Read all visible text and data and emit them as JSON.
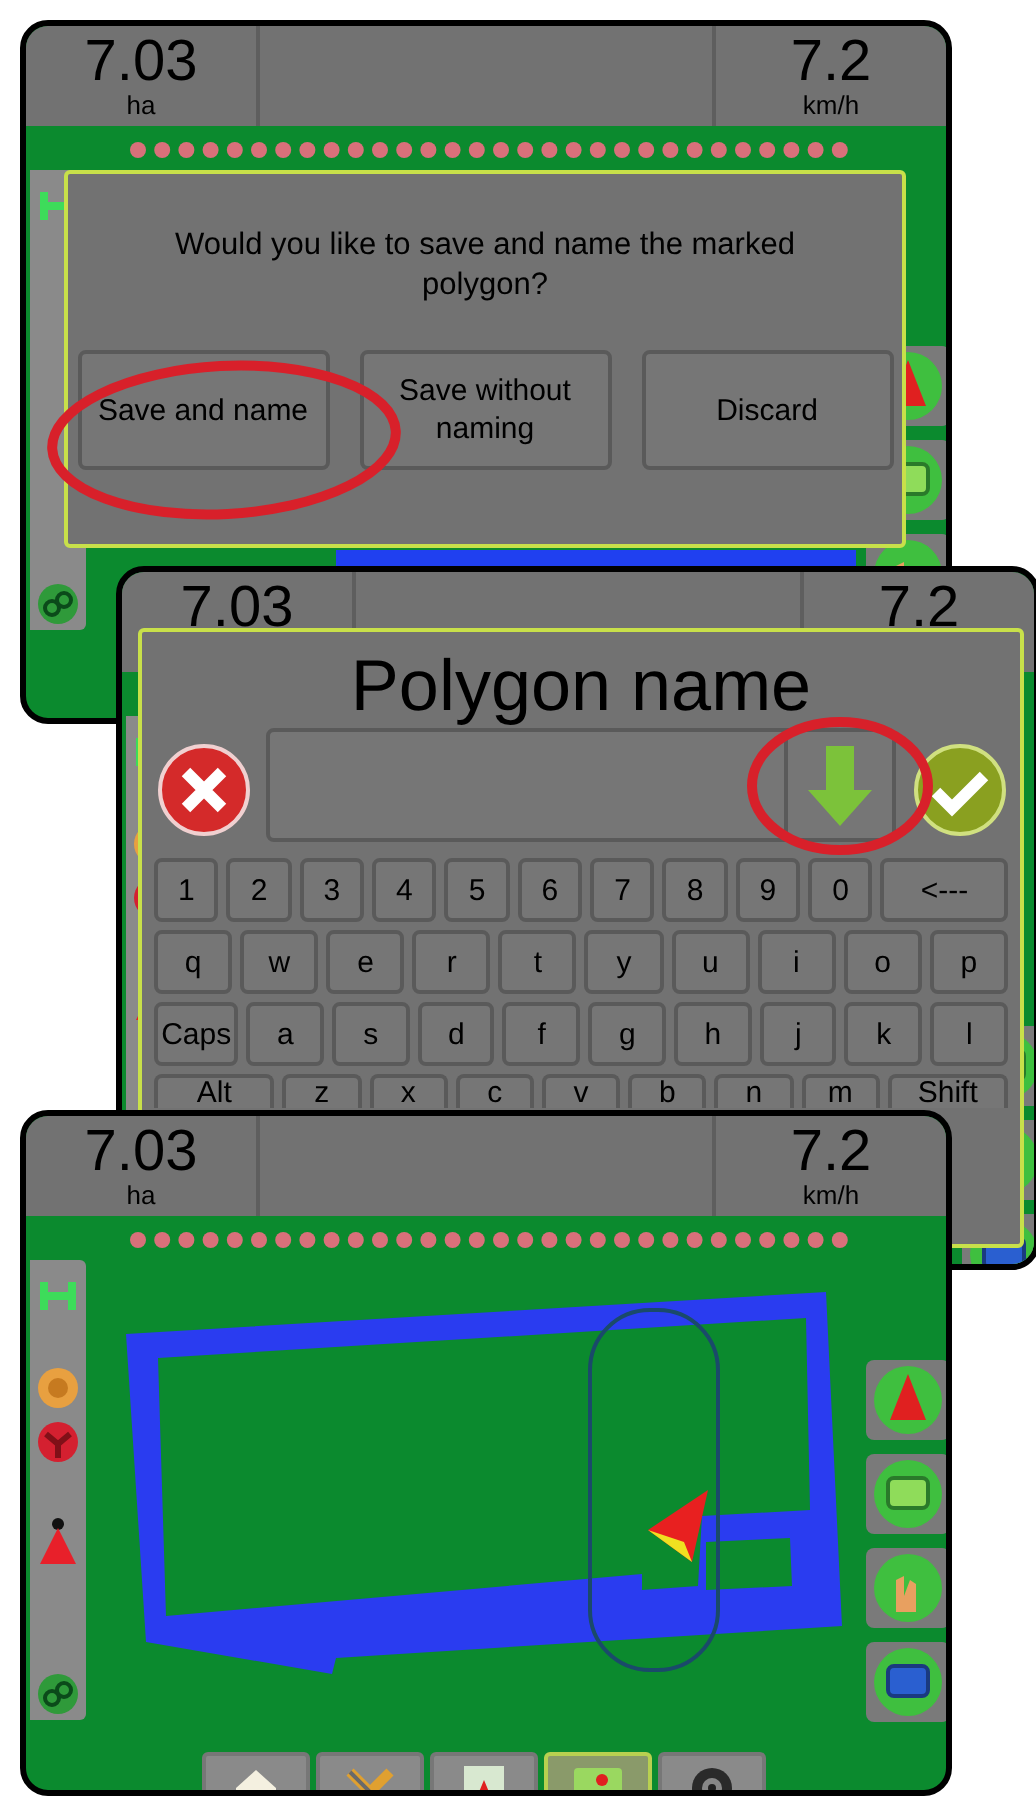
{
  "screens": [
    {
      "kind": "confirm",
      "area": "7.03",
      "area_unit": "ha",
      "speed": "7.2",
      "speed_unit": "km/h",
      "dialog": {
        "message": "Would you like to save and name the marked polygon?",
        "buttons": [
          {
            "label": "Save and name",
            "highlighted": true
          },
          {
            "label": "Save without naming",
            "highlighted": false
          },
          {
            "label": "Discard",
            "highlighted": false
          }
        ]
      }
    },
    {
      "kind": "keyboard",
      "area": "7.03",
      "speed": "7.2",
      "dialog": {
        "title": "Polygon name",
        "enter_highlighted": true,
        "keys": [
          [
            "1",
            "2",
            "3",
            "4",
            "5",
            "6",
            "7",
            "8",
            "9",
            "0",
            "<---"
          ],
          [
            "q",
            "w",
            "e",
            "r",
            "t",
            "y",
            "u",
            "i",
            "o",
            "p"
          ],
          [
            "Caps",
            "a",
            "s",
            "d",
            "f",
            "g",
            "h",
            "j",
            "k",
            "l"
          ],
          [
            "Alt",
            "z",
            "x",
            "c",
            "v",
            "b",
            "n",
            "m",
            "Shift"
          ]
        ]
      }
    },
    {
      "kind": "map",
      "area": "7.03",
      "area_unit": "ha",
      "speed": "7.2",
      "speed_unit": "km/h",
      "bottom_tabs": [
        {
          "selected": false
        },
        {
          "selected": false
        },
        {
          "selected": false
        },
        {
          "selected": true
        },
        {
          "selected": false
        }
      ]
    }
  ]
}
